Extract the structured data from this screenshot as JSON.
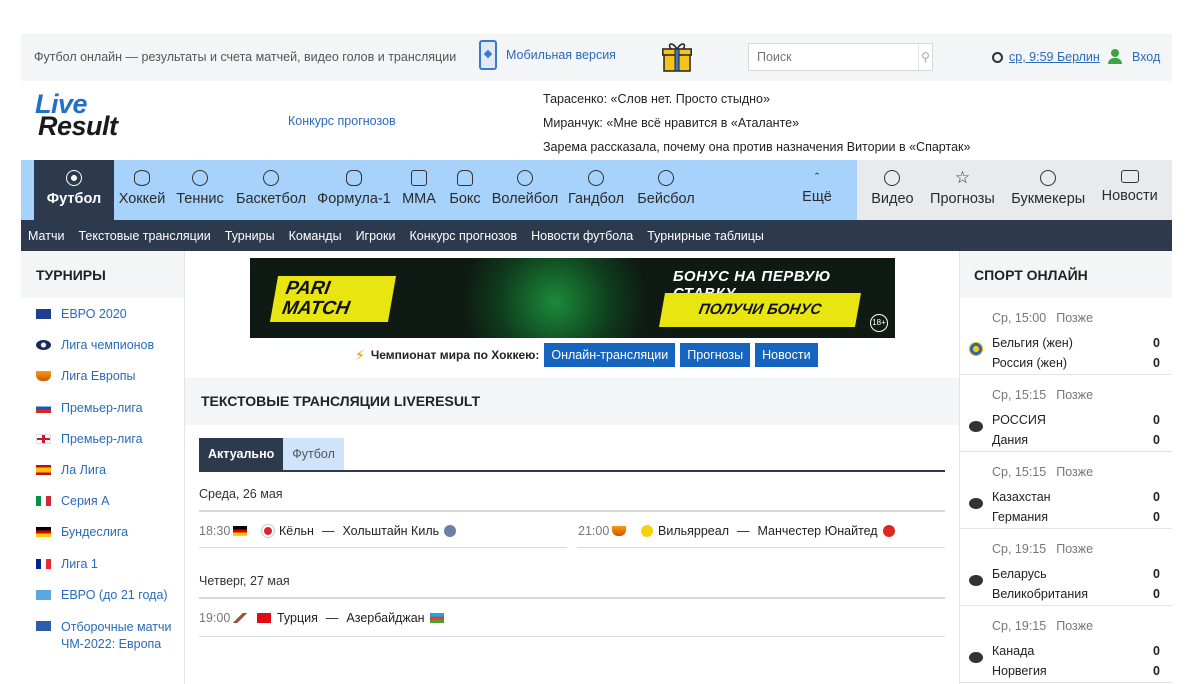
{
  "topbar": {
    "slogan": "Футбол онлайн — результаты и счета матчей, видео голов и трансляции",
    "mobile_label": "Мобильная версия",
    "search_placeholder": "Поиск",
    "clock_text": "ср, 9:59 Берлин",
    "login_label": "Вход"
  },
  "header": {
    "logo_line1": "Live",
    "logo_line2": "Result",
    "contest_link": "Конкурс прогнозов",
    "news": [
      "Тарасенко: «Слов нет. Просто стыдно»",
      "Миранчук: «Мне всё нравится в «Аталанте»",
      "Зарема рассказала, почему она против назначения Витории в «Спартак»"
    ]
  },
  "sportnav": {
    "items": [
      "Футбол",
      "Хоккей",
      "Теннис",
      "Баскетбол",
      "Формула-1",
      "MMA",
      "Бокс",
      "Волейбол",
      "Гандбол",
      "Бейсбол"
    ],
    "more_label": "Ещё",
    "right_items": [
      "Видео",
      "Прогнозы",
      "Букмекеры",
      "Новости"
    ]
  },
  "subnav": {
    "items": [
      "Матчи",
      "Текстовые трансляции",
      "Турниры",
      "Команды",
      "Игроки",
      "Конкурс прогнозов",
      "Новости футбола",
      "Турнирные таблицы"
    ]
  },
  "left": {
    "heading": "ТУРНИРЫ",
    "tournaments": [
      "ЕВРО 2020",
      "Лига чемпионов",
      "Лига Европы",
      "Премьер-лига",
      "Премьер-лига",
      "Ла Лига",
      "Серия А",
      "Бундеслига",
      "Лига 1",
      "ЕВРО (до 21 года)",
      "Отборочные матчи ЧМ-2022: Европа"
    ]
  },
  "banner": {
    "brand": "PARI MATCH",
    "tagline": "БОНУС НА ПЕРВУЮ СТАВКУ",
    "cta": "ПОЛУЧИ БОНУС",
    "age": "18+"
  },
  "worldcup": {
    "label": "Чемпионат мира по Хоккею:",
    "buttons": [
      "Онлайн-трансляции",
      "Прогнозы",
      "Новости"
    ]
  },
  "center": {
    "heading": "ТЕКСТОВЫЕ ТРАНСЛЯЦИИ LIVERESULT",
    "tabs": [
      "Актуально",
      "Футбол"
    ],
    "days": [
      "Среда, 26 мая",
      "Четверг, 27 мая"
    ],
    "matches": [
      {
        "time": "18:30",
        "home": "Кёльн",
        "away": "Хольштайн Киль"
      },
      {
        "time": "21:00",
        "home": "Вильярреал",
        "away": "Манчестер Юнайтед"
      },
      {
        "time": "19:00",
        "home": "Турция",
        "away": "Азербайджан"
      }
    ],
    "dash": "—"
  },
  "right": {
    "heading": "СПОРТ ОНЛАЙН",
    "later_label": "Позже",
    "games": [
      {
        "when": "Ср, 15:00",
        "team1": "Бельгия (жен)",
        "team2": "Россия (жен)",
        "score1": "0",
        "score2": "0"
      },
      {
        "when": "Ср, 15:15",
        "team1": "РОССИЯ",
        "team2": "Дания",
        "score1": "0",
        "score2": "0"
      },
      {
        "when": "Ср, 15:15",
        "team1": "Казахстан",
        "team2": "Германия",
        "score1": "0",
        "score2": "0"
      },
      {
        "when": "Ср, 19:15",
        "team1": "Беларусь",
        "team2": "Великобритания",
        "score1": "0",
        "score2": "0"
      },
      {
        "when": "Ср, 19:15",
        "team1": "Канада",
        "team2": "Норвегия",
        "score1": "0",
        "score2": "0"
      }
    ]
  },
  "colors": {
    "accent_blue": "#1565c0",
    "nav_light": "#a6d2fb",
    "nav_dark": "#2d3a4e",
    "link": "#2a6ab8"
  }
}
